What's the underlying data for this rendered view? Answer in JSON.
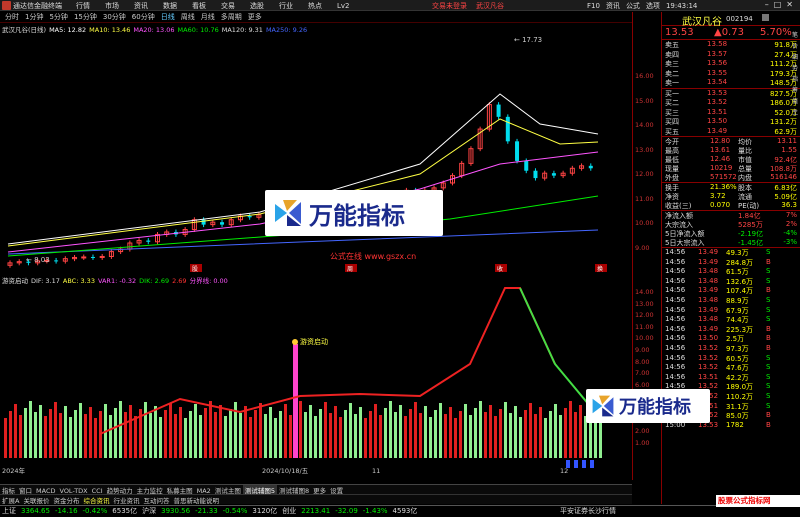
{
  "titlebar": {
    "title": "通达信金融终端",
    "menu": [
      "行情",
      "市场",
      "资讯",
      "数据",
      "看板",
      "交易",
      "选股",
      "行业",
      "热点",
      "Lv2"
    ],
    "alert": "交易未登录",
    "stock": "武汉凡谷",
    "right": [
      "F10",
      "资讯",
      "公式",
      "选项"
    ],
    "time": "19:43:14"
  },
  "periods": {
    "items": [
      "分时",
      "1分钟",
      "5分钟",
      "15分钟",
      "30分钟",
      "60分钟",
      "日线",
      "周线",
      "月线",
      "多周期",
      "更多"
    ],
    "active": "日线"
  },
  "legend": {
    "name": "武汉凡谷(日线)",
    "items": [
      {
        "t": "MA5: 12.82",
        "c": "#ffffff"
      },
      {
        "t": "MA10: 13.46",
        "c": "#ffff44"
      },
      {
        "t": "MA20: 13.06",
        "c": "#ff55ff"
      },
      {
        "t": "MA60: 10.76",
        "c": "#00ee00"
      },
      {
        "t": "MA120: 9.31",
        "c": "#dddddd"
      },
      {
        "t": "MA250: 9.26",
        "c": "#4466ff"
      }
    ]
  },
  "main_axis": [
    "16.00",
    "15.00",
    "14.00",
    "13.00",
    "12.00",
    "11.00",
    "10.00",
    "9.00"
  ],
  "peak_label": "17.73",
  "low_label": "8.03",
  "markers": [
    "股",
    "周",
    "收",
    "换"
  ],
  "site_text": "公式在线 www.gszx.cn",
  "indicator": {
    "name": "游资启动",
    "items": [
      {
        "t": "DIF: 3.17",
        "c": "#dddddd"
      },
      {
        "t": "ABC: 3.33",
        "c": "#ffff44"
      },
      {
        "t": "VAR1: -0.32",
        "c": "#ff55ff"
      },
      {
        "t": "DIK: 2.69",
        "c": "#00ee00"
      },
      {
        "t": "2.69",
        "c": "#ff3333"
      },
      {
        "t": "分界线: 0.00",
        "c": "#ff55ff"
      }
    ],
    "label": "游资启动"
  },
  "ind_axis": [
    "14.00",
    "13.00",
    "12.00",
    "11.00",
    "10.00",
    "9.00",
    "8.00",
    "7.00",
    "6.00",
    "5.25",
    "4.00",
    "3.00",
    "2.00",
    "1.00"
  ],
  "dates": [
    "2024年",
    "2024/10/18/五",
    "11",
    "12"
  ],
  "tabs": [
    "指标",
    "窗口",
    "MACD",
    "VOL-TDX",
    "CCI",
    "趋势动力",
    "主力监控",
    "私募主图",
    "MA2",
    "测试主图",
    "测试辅图5",
    "测试辅图8",
    "更多",
    "设置"
  ],
  "tabs_active": "测试辅图5",
  "tabs2": [
    "扩展A",
    "关联报价",
    "资金分布",
    "综合资讯",
    "行业资讯",
    "互动问答",
    "普思新动能说明"
  ],
  "tabs2_hl": "综合资讯",
  "status": [
    {
      "t": "上证",
      "c": "w"
    },
    {
      "t": "3364.65",
      "c": "g"
    },
    {
      "t": "-14.16",
      "c": "g"
    },
    {
      "t": "-0.42%",
      "c": "g"
    },
    {
      "t": "6535亿",
      "c": "w"
    },
    {
      "t": "沪深",
      "c": "w"
    },
    {
      "t": "3930.56",
      "c": "g"
    },
    {
      "t": "-21.33",
      "c": "g"
    },
    {
      "t": "-0.54%",
      "c": "g"
    },
    {
      "t": "3120亿",
      "c": "w"
    },
    {
      "t": "创业",
      "c": "w"
    },
    {
      "t": "2213.41",
      "c": "g"
    },
    {
      "t": "-32.09",
      "c": "g"
    },
    {
      "t": "-1.43%",
      "c": "g"
    },
    {
      "t": "4593亿",
      "c": "w"
    }
  ],
  "status_right": "平安证券长沙行情",
  "watermark": "万能指标",
  "corner_wm": "股票公式指标网",
  "quote": {
    "name": "武汉凡谷",
    "code": "002194",
    "price": "13.53",
    "change": "▲0.73",
    "pct": "5.70%",
    "asks": [
      {
        "l": "卖五",
        "p": "13.58",
        "v": "91.8万"
      },
      {
        "l": "卖四",
        "p": "13.57",
        "v": "27.4万"
      },
      {
        "l": "卖三",
        "p": "13.56",
        "v": "111.2万"
      },
      {
        "l": "卖二",
        "p": "13.55",
        "v": "179.3万"
      },
      {
        "l": "卖一",
        "p": "13.54",
        "v": "148.5万"
      }
    ],
    "bids": [
      {
        "l": "买一",
        "p": "13.53",
        "v": "827.5万"
      },
      {
        "l": "买二",
        "p": "13.52",
        "v": "186.0万"
      },
      {
        "l": "买三",
        "p": "13.51",
        "v": "52.0万"
      },
      {
        "l": "买四",
        "p": "13.50",
        "v": "131.2万"
      },
      {
        "l": "买五",
        "p": "13.49",
        "v": "62.9万"
      }
    ],
    "stats": [
      [
        "今开",
        "12.80",
        "均价",
        "13.11"
      ],
      [
        "最高",
        "13.61",
        "量比",
        "1.55"
      ],
      [
        "最低",
        "12.46",
        "市值",
        "92.4亿"
      ],
      [
        "现量",
        "10219",
        "总量",
        "108.8万"
      ],
      [
        "外盘",
        "571572",
        "内盘",
        "516146"
      ]
    ],
    "stats2": [
      [
        "换手",
        "21.36%",
        "股本",
        "6.83亿"
      ],
      [
        "净资",
        "3.72",
        "流通",
        "5.09亿"
      ],
      [
        "收益(三)",
        "0.070",
        "PE(动)",
        "36.3"
      ]
    ],
    "flows": [
      [
        "净流入额",
        "1.84亿",
        "7%"
      ],
      [
        "大宗流入",
        "5285万",
        "2%"
      ],
      [
        "5日净流入额",
        "-2.19亿",
        "-4%"
      ],
      [
        "5日大宗流入",
        "-1.45亿",
        "-3%"
      ]
    ],
    "ticks": [
      [
        "14:56",
        "13.49",
        "49.3万",
        "S"
      ],
      [
        "14:56",
        "13.49",
        "284.8万",
        "B"
      ],
      [
        "14:56",
        "13.48",
        "61.5万",
        "S"
      ],
      [
        "14:56",
        "13.48",
        "132.6万",
        "S"
      ],
      [
        "14:56",
        "13.49",
        "107.4万",
        "B"
      ],
      [
        "14:56",
        "13.48",
        "88.9万",
        "S"
      ],
      [
        "14:56",
        "13.49",
        "67.9万",
        "S"
      ],
      [
        "14:56",
        "13.48",
        "74.4万",
        "S"
      ],
      [
        "14:56",
        "13.49",
        "225.3万",
        "B"
      ],
      [
        "14:56",
        "13.50",
        "2.5万",
        "B"
      ],
      [
        "14:56",
        "13.52",
        "97.3万",
        "B"
      ],
      [
        "14:56",
        "13.52",
        "60.5万",
        "S"
      ],
      [
        "14:56",
        "13.52",
        "47.6万",
        "S"
      ],
      [
        "14:56",
        "13.51",
        "42.2万",
        "S"
      ],
      [
        "14:56",
        "13.52",
        "189.0万",
        "S"
      ],
      [
        "14:56",
        "13.52",
        "110.2万",
        "S"
      ],
      [
        "14:56",
        "13.51",
        "31.1万",
        "S"
      ],
      [
        "14:56",
        "13.52",
        "85.0万",
        "B"
      ],
      [
        "15:00",
        "13.53",
        "1782",
        "B"
      ]
    ]
  }
}
